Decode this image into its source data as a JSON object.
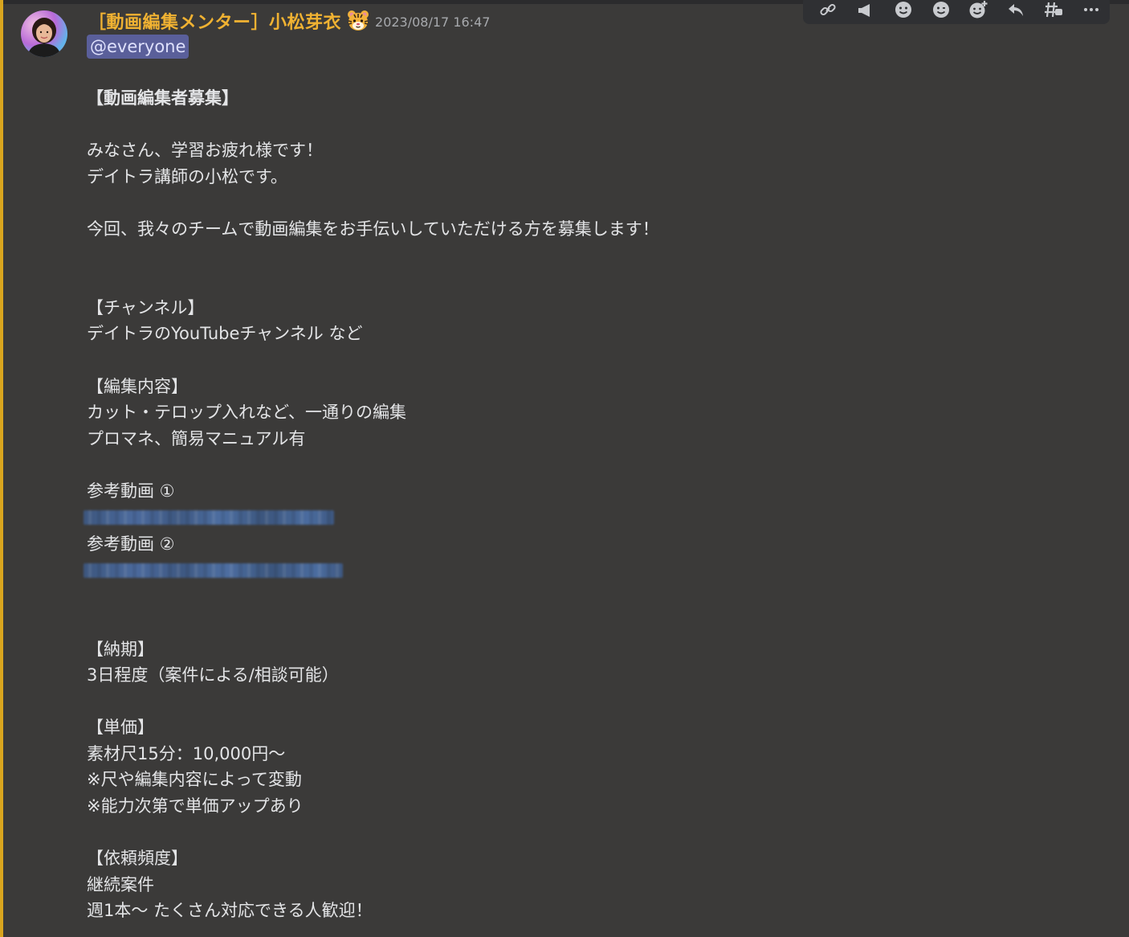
{
  "message": {
    "author": "［動画編集メンター］小松芽衣",
    "role_icon": "tiger-face-icon",
    "timestamp": "2023/08/17 16:47",
    "mention": "@everyone",
    "lines": {
      "title": "【動画編集者募集】",
      "greeting1": "みなさん、学習お疲れ様です！",
      "greeting2": "デイトラ講師の小松です。",
      "intro": "今回、我々のチームで動画編集をお手伝いしていただける方を募集します！",
      "channel_h": "【チャンネル】",
      "channel_v": "デイトラのYouTubeチャンネル など",
      "content_h": "【編集内容】",
      "content_v1": "カット・テロップ入れなど、一通りの編集",
      "content_v2": "プロマネ、簡易マニュアル有",
      "ref1": "参考動画 ①",
      "ref2": "参考動画 ②",
      "deadline_h": "【納期】",
      "deadline_v": "3日程度（案件による/相談可能）",
      "price_h": "【単価】",
      "price_v1": "素材尺15分：10,000円〜",
      "price_v2": "※尺や編集内容によって変動",
      "price_v3": "※能力次第で単価アップあり",
      "freq_h": "【依頼頻度】",
      "freq_v1": "継続案件",
      "freq_v2": "週1本〜 たくさん対応できる人歓迎！"
    },
    "redacted_links": [
      "reference-link-1",
      "reference-link-2"
    ]
  },
  "toolbar": {
    "buttons": [
      "link-icon",
      "megaphone-icon",
      "emoji-reaction-icon",
      "emoji-smile-icon",
      "emoji-add-icon",
      "reply-icon",
      "thread-icon",
      "more-icon"
    ]
  },
  "colors": {
    "background": "#3b3a39",
    "author": "#f0b232",
    "mention_bg": "#5a5f9a",
    "mention_bar": "#d9a51f",
    "text": "#e3e4e6",
    "timestamp": "#a7a9ad"
  }
}
